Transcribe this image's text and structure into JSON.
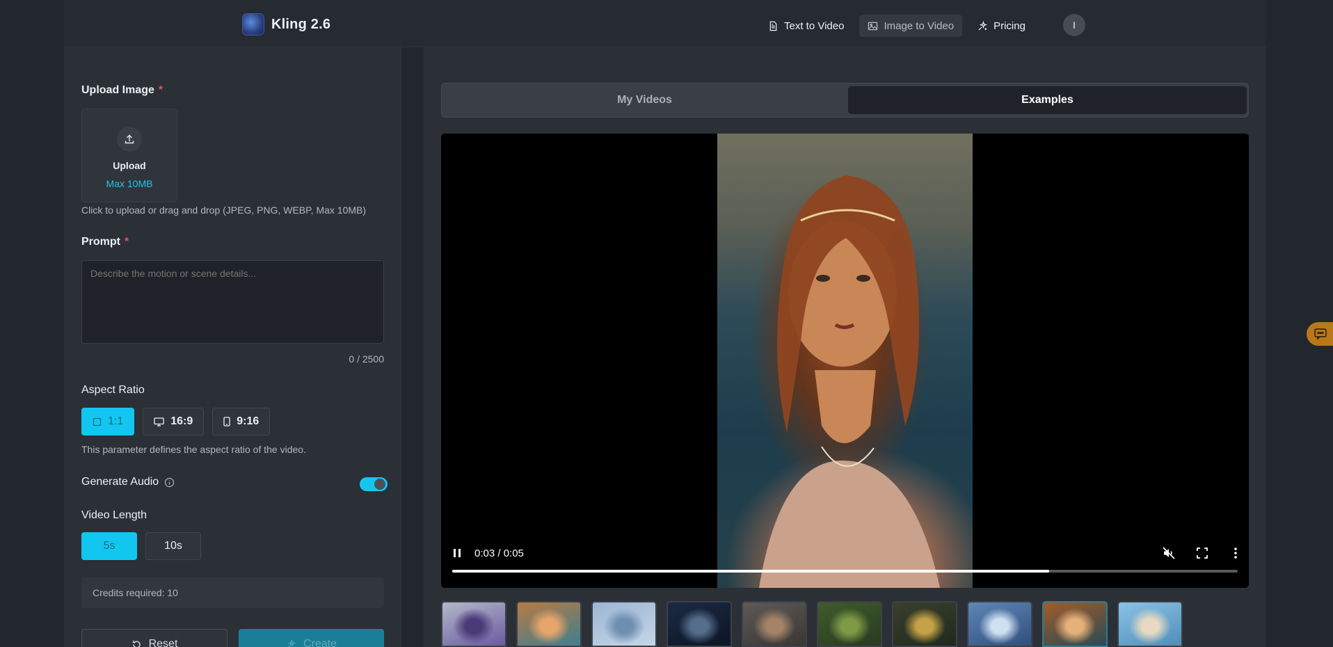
{
  "header": {
    "brand_name": "Kling 2.6",
    "nav": [
      {
        "label": "Text to Video",
        "icon": "document-icon",
        "active": false
      },
      {
        "label": "Image to Video",
        "icon": "image-icon",
        "active": true
      },
      {
        "label": "Pricing",
        "icon": "sparkle-icon",
        "active": false
      }
    ],
    "avatar_initial": "I"
  },
  "form": {
    "upload": {
      "label": "Upload Image",
      "required_mark": "*",
      "button_label": "Upload",
      "max_size": "Max 10MB",
      "hint": "Click to upload or drag and drop (JPEG, PNG, WEBP, Max 10MB)"
    },
    "prompt": {
      "label": "Prompt",
      "required_mark": "*",
      "placeholder": "Describe the motion or scene details...",
      "value": "",
      "counter": "0 / 2500"
    },
    "aspect_ratio": {
      "label": "Aspect Ratio",
      "options": [
        "1:1",
        "16:9",
        "9:16"
      ],
      "selected": "1:1",
      "note": "This parameter defines the aspect ratio of the video."
    },
    "generate_audio": {
      "label": "Generate Audio",
      "enabled": true
    },
    "video_length": {
      "label": "Video Length",
      "options": [
        "5s",
        "10s"
      ],
      "selected": "5s"
    },
    "credits": "Credits required: 10",
    "reset_label": "Reset",
    "create_label": "Create"
  },
  "preview": {
    "tabs": [
      {
        "label": "My Videos",
        "active": false
      },
      {
        "label": "Examples",
        "active": true
      }
    ],
    "player": {
      "state": "playing",
      "time": "0:03 / 0:05",
      "progress": 0.76,
      "muted": true
    },
    "thumbnails": [
      {
        "name": "thumb-anime-girl",
        "colors": [
          "#b2b8c9",
          "#4b3a78",
          "#6c5aa2"
        ]
      },
      {
        "name": "thumb-cat",
        "colors": [
          "#b87a43",
          "#e6a56a",
          "#3d7f90"
        ]
      },
      {
        "name": "thumb-sky-jump",
        "colors": [
          "#9cb6d4",
          "#6f8fb2",
          "#c6d6e6"
        ]
      },
      {
        "name": "thumb-moon",
        "colors": [
          "#1a2a44",
          "#556e8c",
          "#0e1524"
        ]
      },
      {
        "name": "thumb-ruins",
        "colors": [
          "#5d5a57",
          "#a48366",
          "#3a3634"
        ]
      },
      {
        "name": "thumb-forest-path",
        "colors": [
          "#3f5c2c",
          "#7e9a47",
          "#2a3a20"
        ]
      },
      {
        "name": "thumb-christmas",
        "colors": [
          "#3b3f2c",
          "#c6a246",
          "#1f2a1e"
        ]
      },
      {
        "name": "thumb-snow",
        "colors": [
          "#5f86b6",
          "#cfe0f0",
          "#2f4f7e"
        ]
      },
      {
        "name": "thumb-portrait",
        "colors": [
          "#a25c2a",
          "#e6b07a",
          "#2a4a56"
        ],
        "selected": true
      },
      {
        "name": "thumb-beach",
        "colors": [
          "#8cc2e6",
          "#e8dac2",
          "#4f8eb8"
        ]
      }
    ]
  },
  "colors": {
    "accent": "#12c7ef",
    "required": "#e25555",
    "chat_fab": "#b97819"
  }
}
